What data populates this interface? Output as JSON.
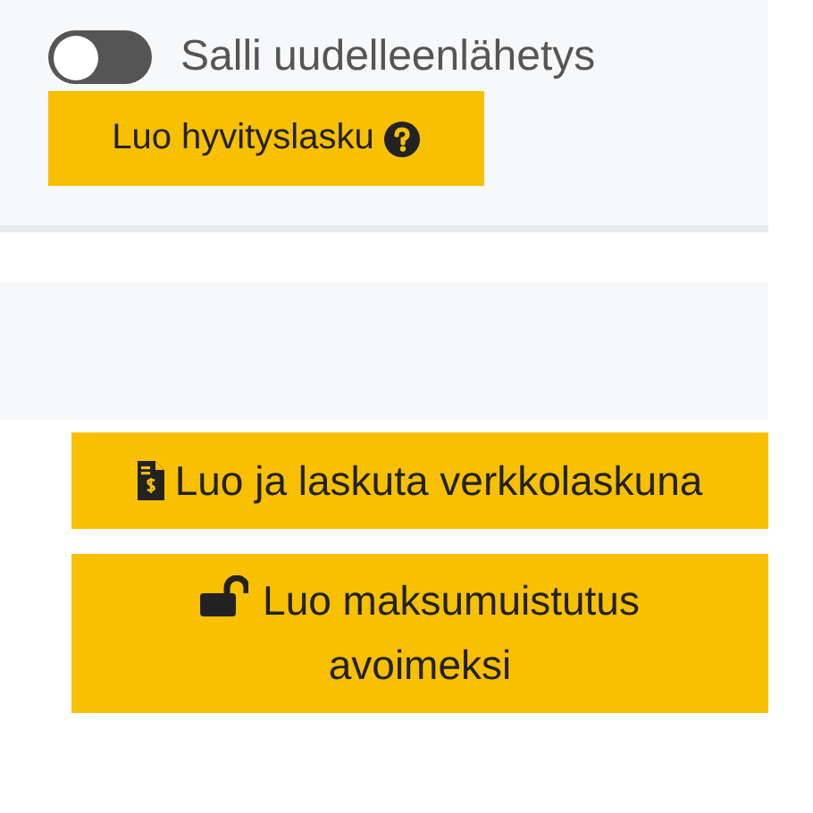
{
  "toggle": {
    "label": "Salli uudelleenlähetys",
    "on": false
  },
  "credit_button": {
    "label": "Luo hyvityslasku"
  },
  "actions": [
    {
      "label": "Luo ja laskuta verkkolaskuna",
      "kind": "invoice"
    },
    {
      "label": "Luo maksumuistutus avoimeksi",
      "kind": "unlock"
    }
  ]
}
